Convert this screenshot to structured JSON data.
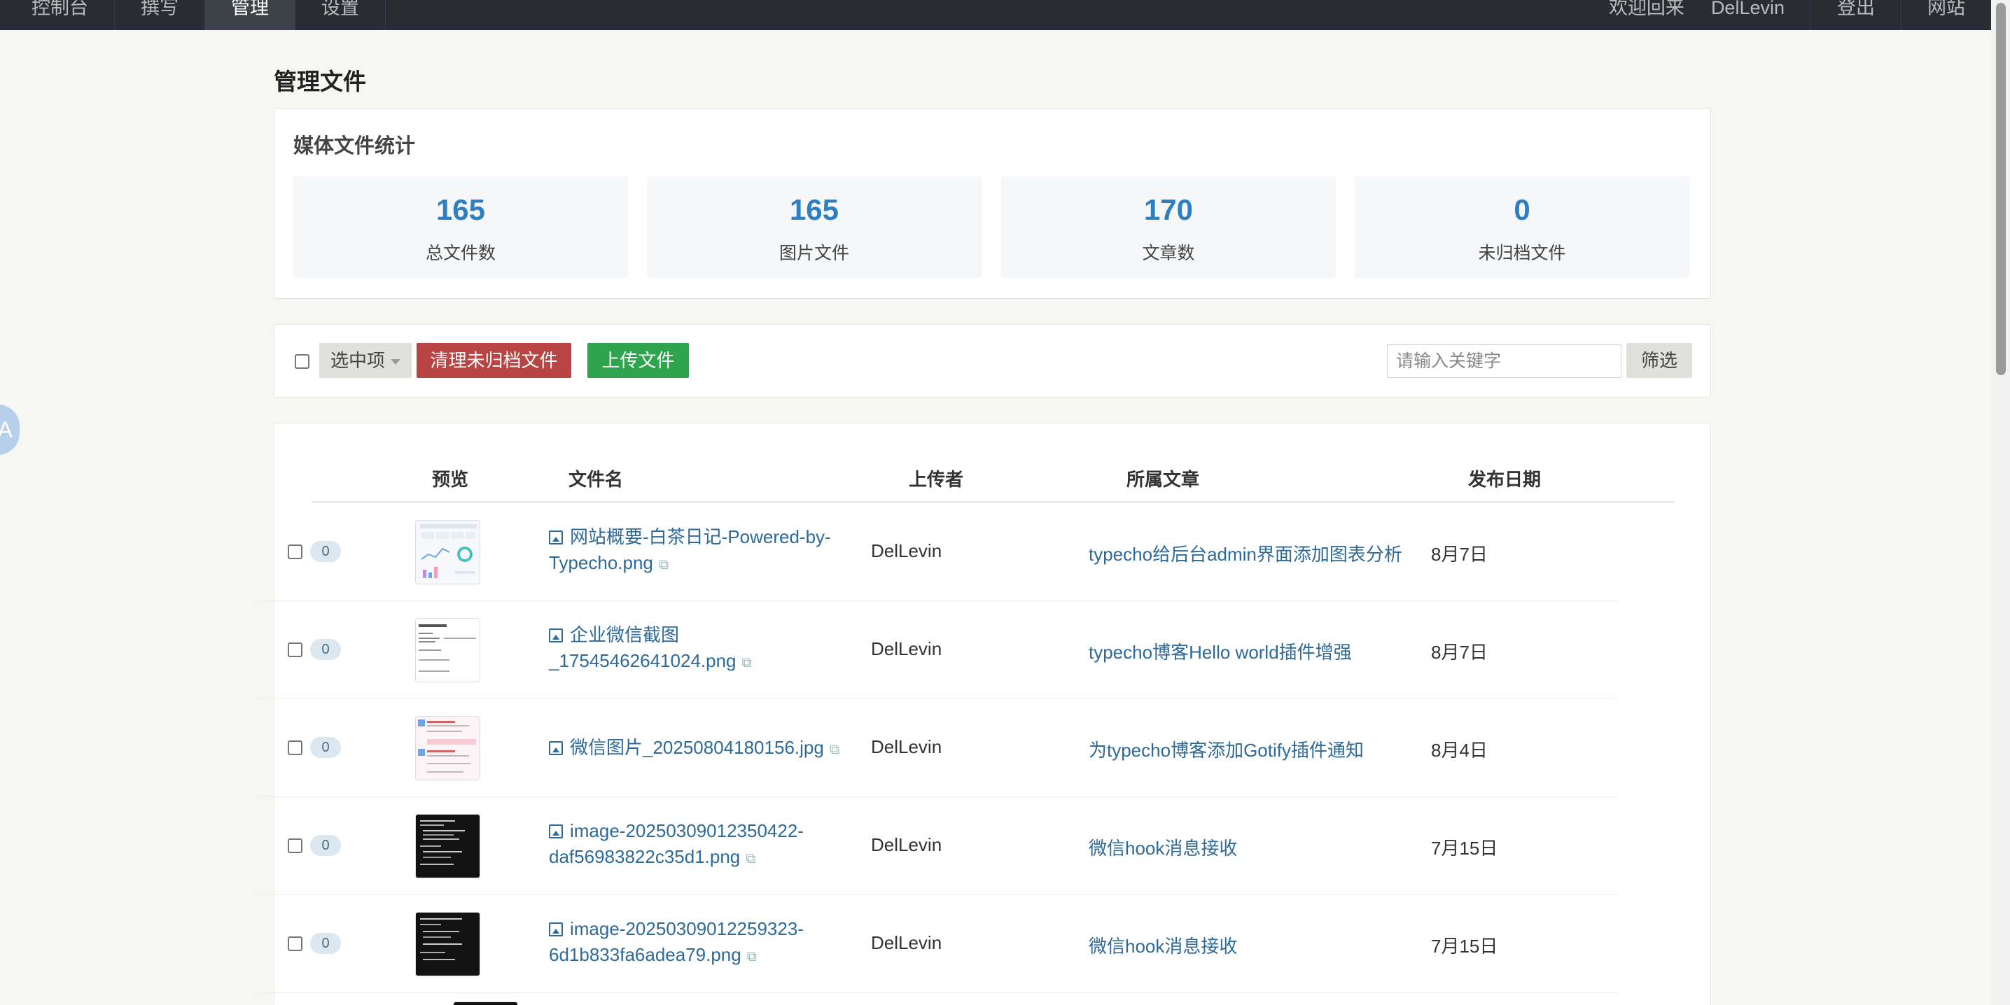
{
  "topbar": {
    "nav": [
      "控制台",
      "撰写",
      "管理",
      "设置"
    ],
    "active_index": 2,
    "welcome": "欢迎回来",
    "user": "DelLevin",
    "logout": "登出",
    "site": "网站"
  },
  "page": {
    "title": "管理文件"
  },
  "stats": {
    "title": "媒体文件统计",
    "cards": [
      {
        "value": "165",
        "label": "总文件数"
      },
      {
        "value": "165",
        "label": "图片文件"
      },
      {
        "value": "170",
        "label": "文章数"
      },
      {
        "value": "0",
        "label": "未归档文件"
      }
    ]
  },
  "toolbar": {
    "select_label": "选中项",
    "clean_label": "清理未归档文件",
    "upload_label": "上传文件",
    "search_placeholder": "请输入关键字",
    "filter_label": "筛选"
  },
  "table": {
    "headers": {
      "preview": "预览",
      "filename": "文件名",
      "uploader": "上传者",
      "article": "所属文章",
      "date": "发布日期"
    },
    "rows": [
      {
        "count": "0",
        "filename": "网站概要-白茶日记-Powered-by-Typecho.png",
        "uploader": "DelLevin",
        "article": "typecho给后台admin界面添加图表分析",
        "date": "8月7日",
        "thumb": "light-dashboard"
      },
      {
        "count": "0",
        "filename": "企业微信截图_17545462641024.png",
        "uploader": "DelLevin",
        "article": "typecho博客Hello world插件增强",
        "date": "8月7日",
        "thumb": "light-text"
      },
      {
        "count": "0",
        "filename": "微信图片_20250804180156.jpg",
        "uploader": "DelLevin",
        "article": "为typecho博客添加Gotify插件通知",
        "date": "8月4日",
        "thumb": "light-pink"
      },
      {
        "count": "0",
        "filename": "image-20250309012350422-daf56983822c35d1.png",
        "uploader": "DelLevin",
        "article": "微信hook消息接收",
        "date": "7月15日",
        "thumb": "dark-terminal"
      },
      {
        "count": "0",
        "filename": "image-20250309012259323-6d1b833fa6adea79.png",
        "uploader": "DelLevin",
        "article": "微信hook消息接收",
        "date": "7月15日",
        "thumb": "dark-terminal"
      }
    ]
  }
}
